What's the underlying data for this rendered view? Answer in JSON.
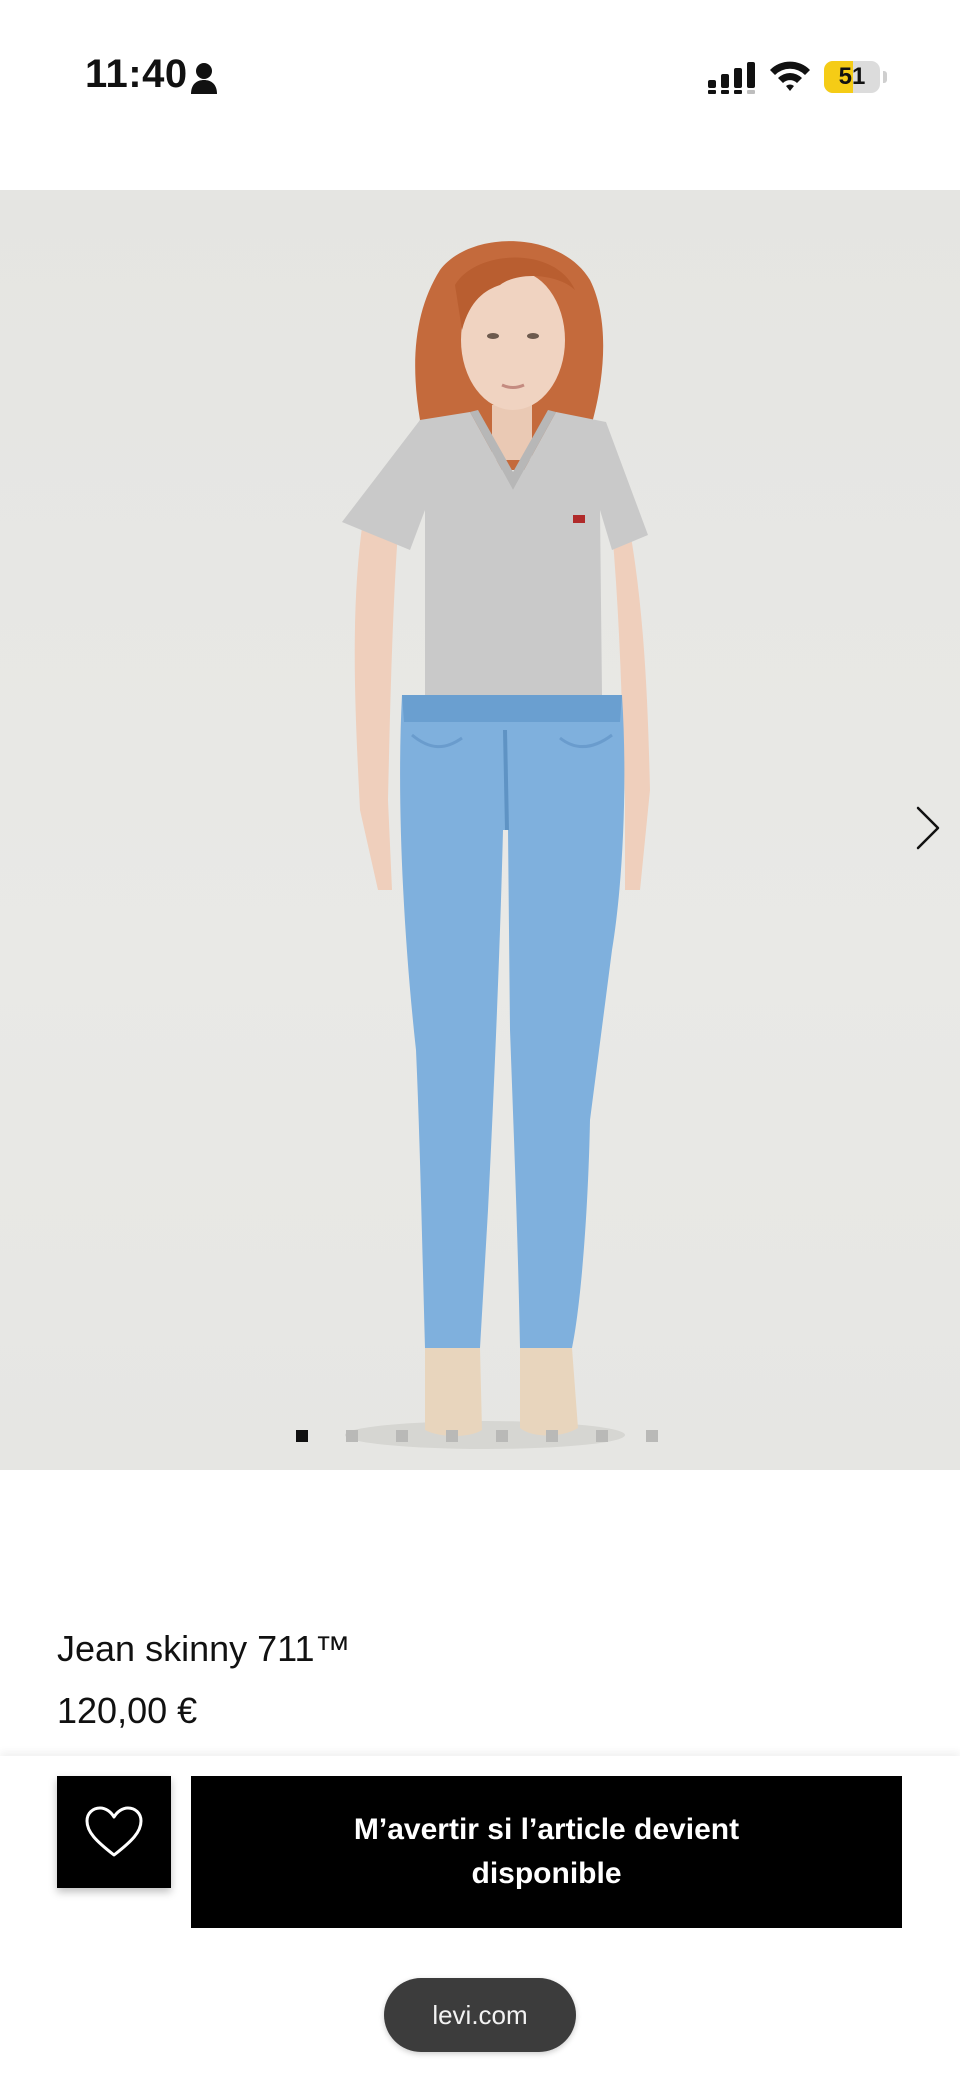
{
  "status_bar": {
    "time": "11:40",
    "battery_level": "51",
    "battery_fraction": 0.51,
    "battery_color": "#f5cc16",
    "icons": [
      "person-icon",
      "signal-icon",
      "wifi-icon",
      "battery-icon"
    ]
  },
  "gallery": {
    "image_icon": "product-photo",
    "next_icon": "chevron-right-icon",
    "slide_count": 8,
    "active_index": 0
  },
  "product": {
    "title": "Jean skinny 711™",
    "price": "120,00 €"
  },
  "actions": {
    "wishlist_icon": "heart-icon",
    "notify_label": "M’avertir si l’article devient disponible",
    "button_color": "#000000"
  },
  "browser": {
    "url": "levi.com"
  }
}
